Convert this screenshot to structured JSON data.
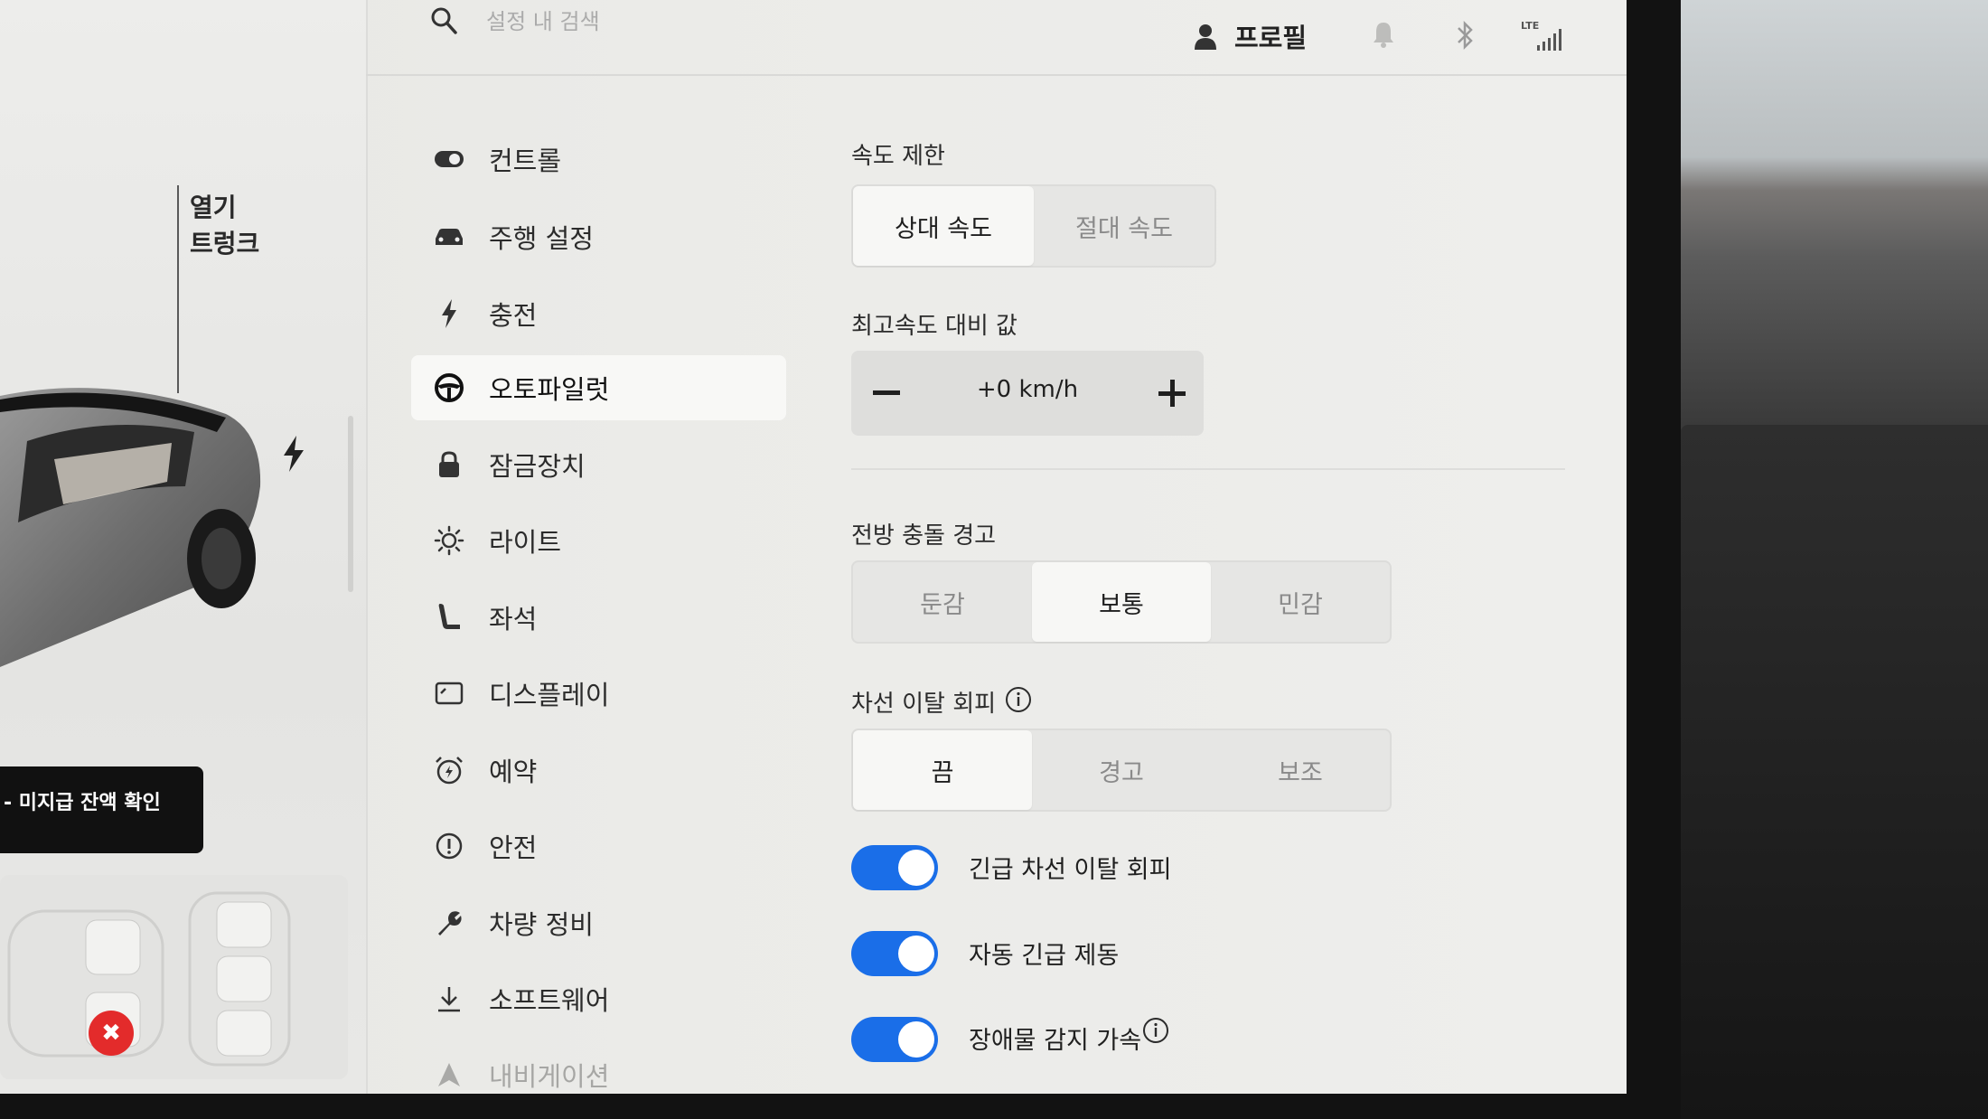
{
  "car_panel": {
    "trunk_label_line1": "열기",
    "trunk_label_line2": "트렁크",
    "notice": "- 미지급 잔액 확인"
  },
  "header": {
    "search_placeholder": "설정 내 검색",
    "profile_label": "프로필",
    "lte_label": "LTE"
  },
  "sidebar": {
    "items": [
      {
        "label": "컨트롤",
        "icon": "toggle-icon"
      },
      {
        "label": "주행 설정",
        "icon": "car-icon"
      },
      {
        "label": "충전",
        "icon": "bolt-icon"
      },
      {
        "label": "오토파일럿",
        "icon": "steering-wheel-icon",
        "active": true
      },
      {
        "label": "잠금장치",
        "icon": "lock-icon"
      },
      {
        "label": "라이트",
        "icon": "light-icon"
      },
      {
        "label": "좌석",
        "icon": "seat-icon"
      },
      {
        "label": "디스플레이",
        "icon": "display-icon"
      },
      {
        "label": "예약",
        "icon": "alarm-clock-icon"
      },
      {
        "label": "안전",
        "icon": "alert-circle-icon"
      },
      {
        "label": "차량 정비",
        "icon": "wrench-icon"
      },
      {
        "label": "소프트웨어",
        "icon": "download-icon"
      },
      {
        "label": "내비게이션",
        "icon": "navigation-icon"
      }
    ]
  },
  "autopilot": {
    "speed_limit": {
      "title": "속도 제한",
      "options": [
        "상대 속도",
        "절대 속도"
      ],
      "selected": "상대 속도"
    },
    "speed_offset": {
      "title": "최고속도 대비 값",
      "value": "+0 km/h"
    },
    "forward_collision": {
      "title": "전방 충돌 경고",
      "options": [
        "둔감",
        "보통",
        "민감"
      ],
      "selected": "보통"
    },
    "lane_departure": {
      "title": "차선 이탈 회피",
      "options": [
        "끔",
        "경고",
        "보조"
      ],
      "selected": "끔"
    },
    "toggles": [
      {
        "label": "긴급 차선 이탈 회피",
        "on": true
      },
      {
        "label": "자동 긴급 제동",
        "on": true
      },
      {
        "label": "장애물 감지 가속",
        "on": true
      }
    ],
    "accent_color": "#1a6ee8"
  }
}
